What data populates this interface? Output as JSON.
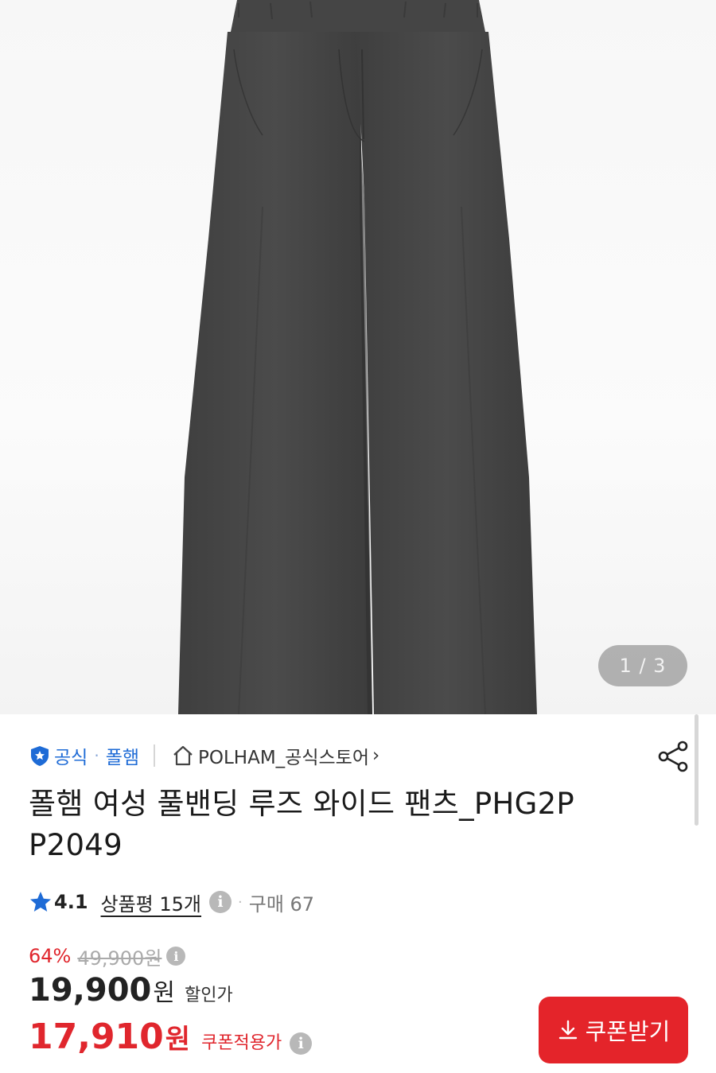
{
  "product_image": {
    "counter": "1 / 3",
    "pants_color": "#4a4a4a"
  },
  "seller": {
    "official_label": "공식",
    "dot": "·",
    "brand": "폴햄",
    "store": "POLHAM_공식스토어",
    "chevron": "›"
  },
  "product": {
    "title": "폴햄 여성 풀밴딩 루즈 와이드 팬츠_PHG2P P2049"
  },
  "rating": {
    "score": "4.1",
    "reviews": "상품평 15개",
    "purchase": "구매 67"
  },
  "price": {
    "discount_rate": "64%",
    "original": "49,900원",
    "sale_price": "19,900",
    "sale_won": "원",
    "sale_label": "할인가",
    "coupon_price": "17,910",
    "coupon_won": "원",
    "coupon_label": "쿠폰적용가"
  },
  "coupon_button": {
    "label": "쿠폰받기"
  },
  "colors": {
    "accent_red": "#e0262d",
    "link_blue": "#1e6bd6",
    "star_blue": "#1e6bd6"
  },
  "icons": {
    "official_badge": "shield-star-icon",
    "home": "home-icon",
    "share": "share-icon",
    "star": "star-icon",
    "info": "info-icon",
    "download": "download-icon"
  }
}
